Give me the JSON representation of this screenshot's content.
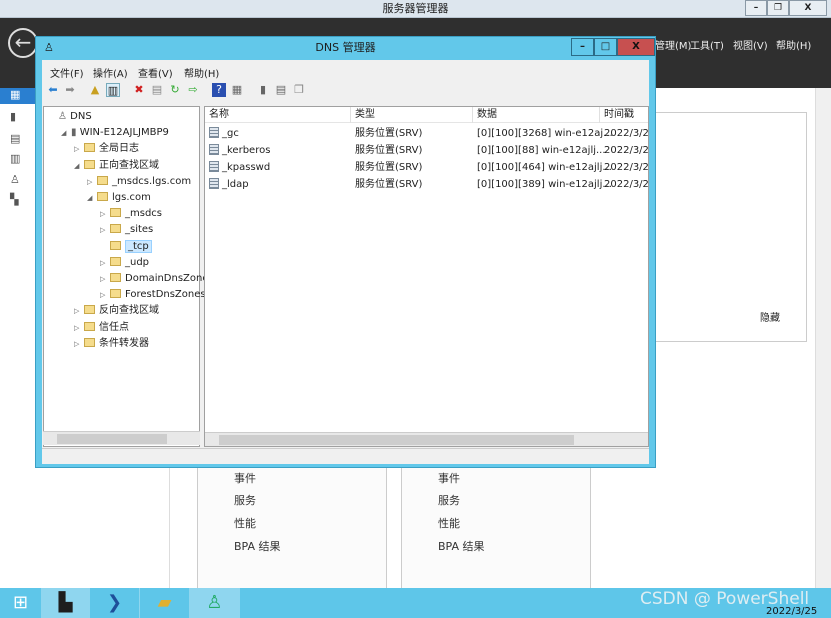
{
  "server_manager": {
    "title": "服务器管理器",
    "window_buttons": {
      "min": "–",
      "restore": "❐",
      "close": "X"
    },
    "menu": [
      "管理(M)",
      "工具(T)",
      "视图(V)",
      "帮助(H)"
    ],
    "sidebar_icons": [
      "dashboard-icon",
      "local-server-icon",
      "all-servers-icon",
      "ad-ds-icon",
      "dns-icon",
      "file-services-icon"
    ],
    "hide_label": "隐藏",
    "cards": [
      {
        "items": [
          "事件",
          "服务",
          "性能",
          "BPA 结果"
        ]
      },
      {
        "items": [
          "事件",
          "服务",
          "性能",
          "BPA 结果"
        ]
      }
    ]
  },
  "dns": {
    "title": "DNS 管理器",
    "window_buttons": {
      "min": "–",
      "max": "□",
      "close": "X"
    },
    "menu": [
      "文件(F)",
      "操作(A)",
      "查看(V)",
      "帮助(H)"
    ],
    "tree": [
      {
        "label": "DNS",
        "level": 0,
        "expander": ""
      },
      {
        "label": "WIN-E12AJLJMBP9",
        "level": 1,
        "expander": "◢"
      },
      {
        "label": "全局日志",
        "level": 2,
        "expander": "▷"
      },
      {
        "label": "正向查找区域",
        "level": 2,
        "expander": "◢"
      },
      {
        "label": "_msdcs.lgs.com",
        "level": 3,
        "expander": "▷"
      },
      {
        "label": "lgs.com",
        "level": 3,
        "expander": "◢"
      },
      {
        "label": "_msdcs",
        "level": 4,
        "expander": "▷"
      },
      {
        "label": "_sites",
        "level": 4,
        "expander": "▷"
      },
      {
        "label": "_tcp",
        "level": 4,
        "expander": "",
        "selected": true
      },
      {
        "label": "_udp",
        "level": 4,
        "expander": "▷"
      },
      {
        "label": "DomainDnsZones",
        "level": 4,
        "expander": "▷"
      },
      {
        "label": "ForestDnsZones",
        "level": 4,
        "expander": "▷"
      },
      {
        "label": "反向查找区域",
        "level": 2,
        "expander": "▷"
      },
      {
        "label": "信任点",
        "level": 2,
        "expander": "▷"
      },
      {
        "label": "条件转发器",
        "level": 2,
        "expander": "▷"
      }
    ],
    "columns": [
      "名称",
      "类型",
      "数据",
      "时间戳"
    ],
    "rows": [
      [
        "_gc",
        "服务位置(SRV)",
        "[0][100][3268] win-e12aj...",
        "2022/3/2"
      ],
      [
        "_kerberos",
        "服务位置(SRV)",
        "[0][100][88] win-e12ajlj...",
        "2022/3/2"
      ],
      [
        "_kpasswd",
        "服务位置(SRV)",
        "[0][100][464] win-e12ajlj...",
        "2022/3/2"
      ],
      [
        "_ldap",
        "服务位置(SRV)",
        "[0][100][389] win-e12ajlj...",
        "2022/3/2"
      ]
    ]
  },
  "taskbar": {
    "date": "2022/3/25",
    "watermark": "CSDN @ PowerShell"
  }
}
